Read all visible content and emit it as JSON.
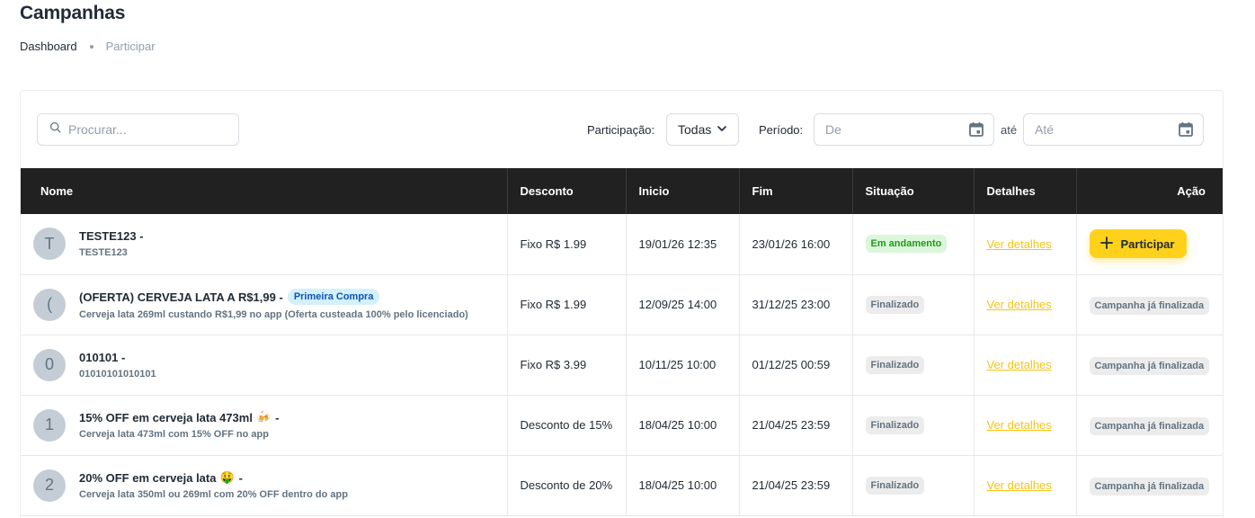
{
  "page": {
    "title": "Campanhas"
  },
  "breadcrumb": {
    "items": [
      "Dashboard",
      "Participar"
    ]
  },
  "toolbar": {
    "search_placeholder": "Procurar...",
    "participacao_label": "Participação:",
    "participacao_value": "Todas",
    "periodo_label": "Período:",
    "de_placeholder": "De",
    "ate_label": "até",
    "ate_placeholder": "Até"
  },
  "table": {
    "headers": [
      "Nome",
      "Desconto",
      "Inicio",
      "Fim",
      "Situação",
      "Detalhes",
      "Ação"
    ],
    "rows": [
      {
        "avatar": "T",
        "name": "TESTE123 -",
        "tag": "",
        "emoji": "",
        "sub": "TESTE123",
        "discount": "Fixo R$ 1.99",
        "start": "19/01/26 12:35",
        "end": "23/01/26 16:00",
        "status": "Em andamento",
        "status_type": "andamento",
        "details": "Ver detalhes",
        "action": "Participar",
        "action_type": "button"
      },
      {
        "avatar": "(",
        "name": "(OFERTA) CERVEJA LATA A R$1,99 -",
        "tag": "Primeira Compra",
        "emoji": "",
        "sub": "Cerveja lata 269ml custando R$1,99 no app (Oferta custeada 100% pelo licenciado)",
        "discount": "Fixo R$ 1.99",
        "start": "12/09/25 14:00",
        "end": "31/12/25 23:00",
        "status": "Finalizado",
        "status_type": "finalizado",
        "details": "Ver detalhes",
        "action": "Campanha já finalizada",
        "action_type": "badge"
      },
      {
        "avatar": "0",
        "name": "010101 -",
        "tag": "",
        "emoji": "",
        "sub": "01010101010101",
        "discount": "Fixo R$ 3.99",
        "start": "10/11/25 10:00",
        "end": "01/12/25 00:59",
        "status": "Finalizado",
        "status_type": "finalizado",
        "details": "Ver detalhes",
        "action": "Campanha já finalizada",
        "action_type": "badge"
      },
      {
        "avatar": "1",
        "name": "15% OFF em cerveja lata 473ml",
        "tag": "",
        "emoji": "🍻",
        "name_suffix": "-",
        "sub": "Cerveja lata 473ml com 15% OFF no app",
        "discount": "Desconto de 15%",
        "start": "18/04/25 10:00",
        "end": "21/04/25 23:59",
        "status": "Finalizado",
        "status_type": "finalizado",
        "details": "Ver detalhes",
        "action": "Campanha já finalizada",
        "action_type": "badge"
      },
      {
        "avatar": "2",
        "name": "20% OFF em cerveja lata",
        "tag": "",
        "emoji": "🤑",
        "name_suffix": "-",
        "sub": "Cerveja lata 350ml ou 269ml com 20% OFF dentro do app",
        "discount": "Desconto de 20%",
        "start": "18/04/25 10:00",
        "end": "21/04/25 23:59",
        "status": "Finalizado",
        "status_type": "finalizado",
        "details": "Ver detalhes",
        "action": "Campanha já finalizada",
        "action_type": "badge"
      }
    ]
  },
  "colors": {
    "accent": "#ffd11a",
    "header_bg": "#212121",
    "link": "#f5c518",
    "status_green": "#229a16"
  },
  "icons": {
    "search": "search-icon",
    "chevron": "chevron-down-icon",
    "calendar": "calendar-icon",
    "plus": "plus-icon"
  }
}
